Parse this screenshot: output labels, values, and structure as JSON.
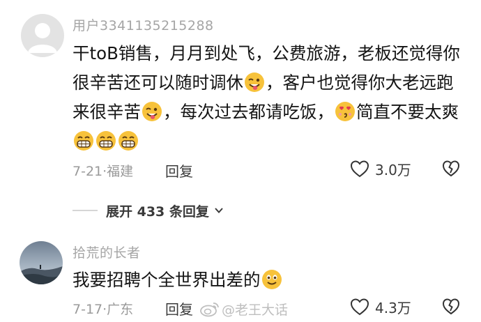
{
  "comments": [
    {
      "username": "用户3341135215288",
      "text_segments": [
        "干toB销售，月月到处飞，公费旅游，老板还觉得你很辛苦还可以随时调休",
        "，客户也觉得你大老远跑来很辛苦",
        "，每次过去都请吃饭，",
        "简直不要太爽"
      ],
      "emojis": [
        "wink-tongue-emoji",
        "wink-tongue-emoji",
        "heart-eyes-kiss-emoji",
        "grin-emoji",
        "grin-emoji",
        "grin-emoji"
      ],
      "date": "7-21",
      "location": "福建",
      "reply_label": "回复",
      "likes": "3.0万"
    },
    {
      "username": "拾荒的长者",
      "text_segments": [
        "我要招聘个全世界出差的"
      ],
      "emojis": [
        "smile-emoji"
      ],
      "date": "7-17",
      "location": "广东",
      "reply_label": "回复",
      "likes": "4.3万"
    }
  ],
  "expand_replies": {
    "label": "展开 433 条回复"
  },
  "watermark": {
    "text": "@老王大话"
  },
  "colors": {
    "text": "#141414",
    "secondary": "#9a9a9a",
    "emoji_yellow": "#f7c23b"
  }
}
